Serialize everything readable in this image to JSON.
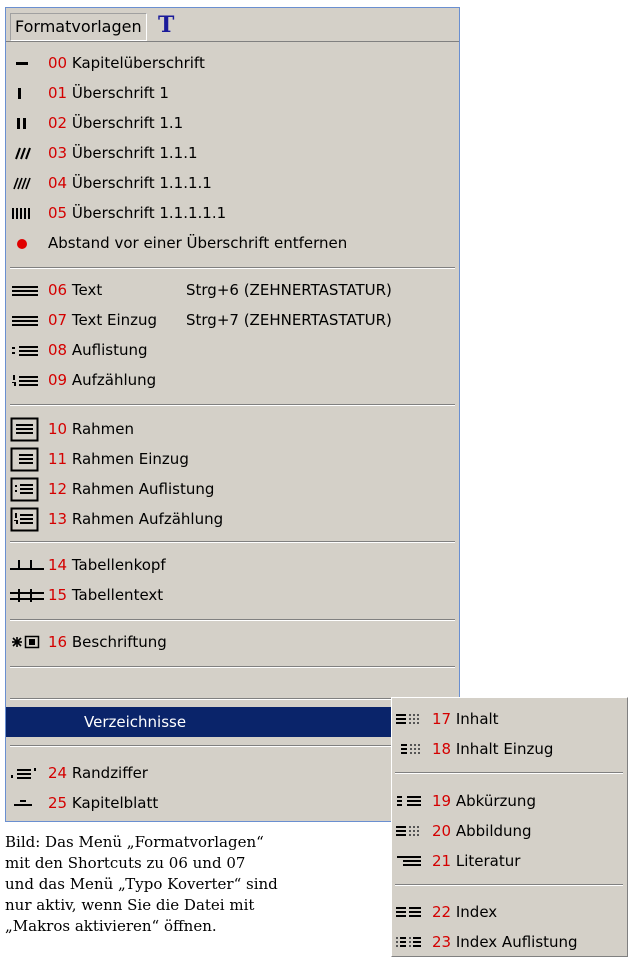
{
  "menubar": {
    "title": "Formatvorlagen",
    "tool_glyph": "T"
  },
  "items": [
    {
      "num": "00",
      "label": "Kapitelüberschrift",
      "icon": "heading-level-0-icon"
    },
    {
      "num": "01",
      "label": "Überschrift 1",
      "icon": "heading-level-1-icon"
    },
    {
      "num": "02",
      "label": "Überschrift 1.1",
      "icon": "heading-level-2-icon"
    },
    {
      "num": "03",
      "label": "Überschrift 1.1.1",
      "icon": "heading-level-3-icon"
    },
    {
      "num": "04",
      "label": "Überschrift 1.1.1.1",
      "icon": "heading-level-4-icon"
    },
    {
      "num": "05",
      "label": "Überschrift 1.1.1.1.1",
      "icon": "heading-level-5-icon"
    },
    {
      "num": "",
      "label": "Abstand vor einer Überschrift entfernen",
      "icon": "red-dot-icon"
    },
    {
      "num": "06",
      "label": "Text",
      "shortcut": "Strg+6 (ZEHNERTASTATUR)",
      "icon": "text-lines-icon"
    },
    {
      "num": "07",
      "label": "Text Einzug",
      "shortcut": "Strg+7 (ZEHNERTASTATUR)",
      "icon": "indent-lines-icon"
    },
    {
      "num": "08",
      "label": "Auflistung",
      "icon": "bullet-list-icon"
    },
    {
      "num": "09",
      "label": "Aufzählung",
      "icon": "numbered-list-icon"
    },
    {
      "num": "10",
      "label": "Rahmen",
      "icon": "frame-icon"
    },
    {
      "num": "11",
      "label": "Rahmen Einzug",
      "icon": "frame-indent-icon"
    },
    {
      "num": "12",
      "label": "Rahmen Auflistung",
      "icon": "frame-bullet-icon"
    },
    {
      "num": "13",
      "label": "Rahmen Aufzählung",
      "icon": "frame-number-icon"
    },
    {
      "num": "14",
      "label": "Tabellenkopf",
      "icon": "table-head-icon"
    },
    {
      "num": "15",
      "label": "Tabellentext",
      "icon": "table-text-icon"
    },
    {
      "num": "16",
      "label": "Beschriftung",
      "icon": "caption-icon"
    },
    {
      "num": "",
      "label": "Verzeichnisse",
      "icon": ""
    },
    {
      "num": "24",
      "label": "Randziffer",
      "icon": "margin-number-icon"
    },
    {
      "num": "25",
      "label": "Kapitelblatt",
      "icon": "chapter-page-icon"
    }
  ],
  "submenu": [
    {
      "num": "17",
      "label": "Inhalt",
      "icon": "toc-icon"
    },
    {
      "num": "18",
      "label": "Inhalt Einzug",
      "icon": "toc-indent-icon"
    },
    {
      "num": "19",
      "label": "Abkürzung",
      "icon": "abbreviation-icon"
    },
    {
      "num": "20",
      "label": "Abbildung",
      "icon": "figure-list-icon"
    },
    {
      "num": "21",
      "label": "Literatur",
      "icon": "literature-icon"
    },
    {
      "num": "22",
      "label": "Index",
      "icon": "index-icon"
    },
    {
      "num": "23",
      "label": "Index Auflistung",
      "icon": "index-list-icon"
    }
  ],
  "caption": [
    "Bild: Das Menü „Formatvorlagen“",
    "mit den Shortcuts zu 06 und 07",
    "und das Menü „Typo Koverter“ sind",
    "nur aktiv, wenn Sie die Datei mit",
    "„Makros aktivieren“ öffnen."
  ],
  "colors": {
    "menu_bg": "#d4d0c8",
    "highlight": "#0a246a",
    "number": "#d40000"
  }
}
